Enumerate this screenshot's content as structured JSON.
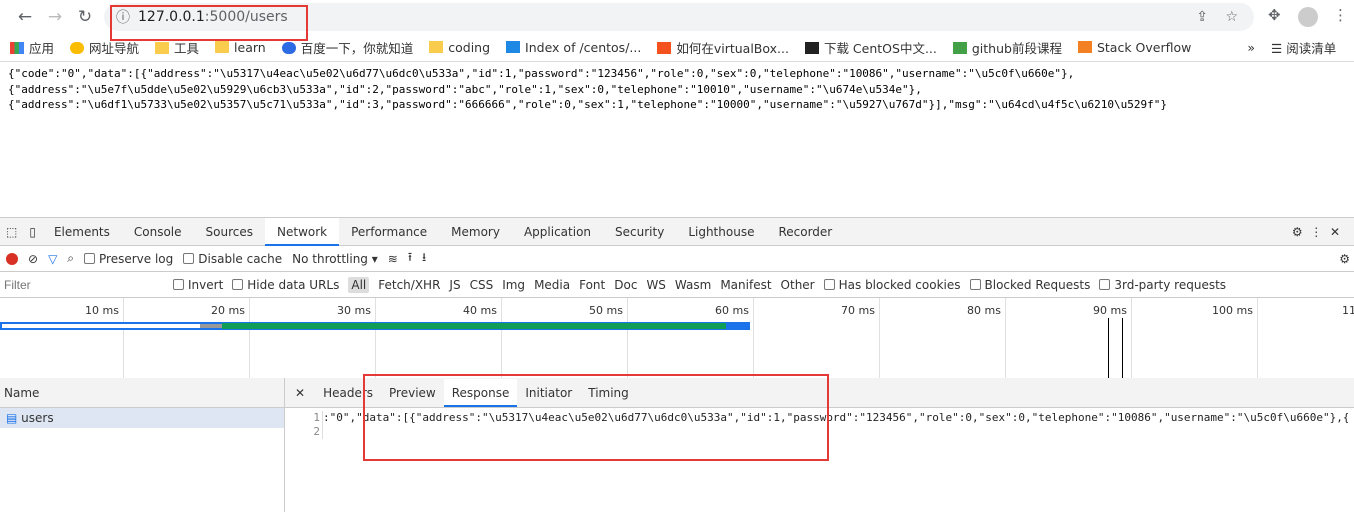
{
  "browser": {
    "url_host": "127.0.0.1",
    "url_path": ":5000/users",
    "bookmarks": [
      "应用",
      "网址导航",
      "工具",
      "learn",
      "百度一下，你就知道",
      "coding",
      "Index of /centos/...",
      "如何在virtualBox...",
      "下载 CentOS中文...",
      "github前段课程",
      "Stack Overflow"
    ],
    "bookmark_more": "»",
    "reading_list": "阅读清单"
  },
  "page": {
    "lines": [
      "{\"code\":\"0\",\"data\":[{\"address\":\"\\u5317\\u4eac\\u5e02\\u6d77\\u6dc0\\u533a\",\"id\":1,\"password\":\"123456\",\"role\":0,\"sex\":0,\"telephone\":\"10086\",\"username\":\"\\u5c0f\\u660e\"},",
      "{\"address\":\"\\u5e7f\\u5dde\\u5e02\\u5929\\u6cb3\\u533a\",\"id\":2,\"password\":\"abc\",\"role\":1,\"sex\":0,\"telephone\":\"10010\",\"username\":\"\\u674e\\u534e\"},",
      "{\"address\":\"\\u6df1\\u5733\\u5e02\\u5357\\u5c71\\u533a\",\"id\":3,\"password\":\"666666\",\"role\":0,\"sex\":1,\"telephone\":\"10000\",\"username\":\"\\u5927\\u767d\"}],\"msg\":\"\\u64cd\\u4f5c\\u6210\\u529f\"}"
    ]
  },
  "devtools": {
    "tabs": [
      "Elements",
      "Console",
      "Sources",
      "Network",
      "Performance",
      "Memory",
      "Application",
      "Security",
      "Lighthouse",
      "Recorder"
    ],
    "active_tab": "Network",
    "toolbar": {
      "preserve_log": "Preserve log",
      "disable_cache": "Disable cache",
      "throttling": "No throttling"
    },
    "filter": {
      "placeholder": "Filter",
      "invert": "Invert",
      "hide_data_urls": "Hide data URLs",
      "types": [
        "All",
        "Fetch/XHR",
        "JS",
        "CSS",
        "Img",
        "Media",
        "Font",
        "Doc",
        "WS",
        "Wasm",
        "Manifest",
        "Other"
      ],
      "has_blocked_cookies": "Has blocked cookies",
      "blocked_requests": "Blocked Requests",
      "third_party": "3rd-party requests"
    },
    "timeline_ticks": [
      "10 ms",
      "20 ms",
      "30 ms",
      "40 ms",
      "50 ms",
      "60 ms",
      "70 ms",
      "80 ms",
      "90 ms",
      "100 ms",
      "11"
    ],
    "name_header": "Name",
    "requests": [
      "users"
    ],
    "detail_tabs": [
      "Headers",
      "Preview",
      "Response",
      "Initiator",
      "Timing"
    ],
    "active_detail": "Response",
    "response_lines": [
      ":\"0\",\"data\":[{\"address\":\"\\u5317\\u4eac\\u5e02\\u6d77\\u6dc0\\u533a\",\"id\":1,\"password\":\"123456\",\"role\":0,\"sex\":0,\"telephone\":\"10086\",\"username\":\"\\u5c0f\\u660e\"},{",
      ""
    ]
  }
}
